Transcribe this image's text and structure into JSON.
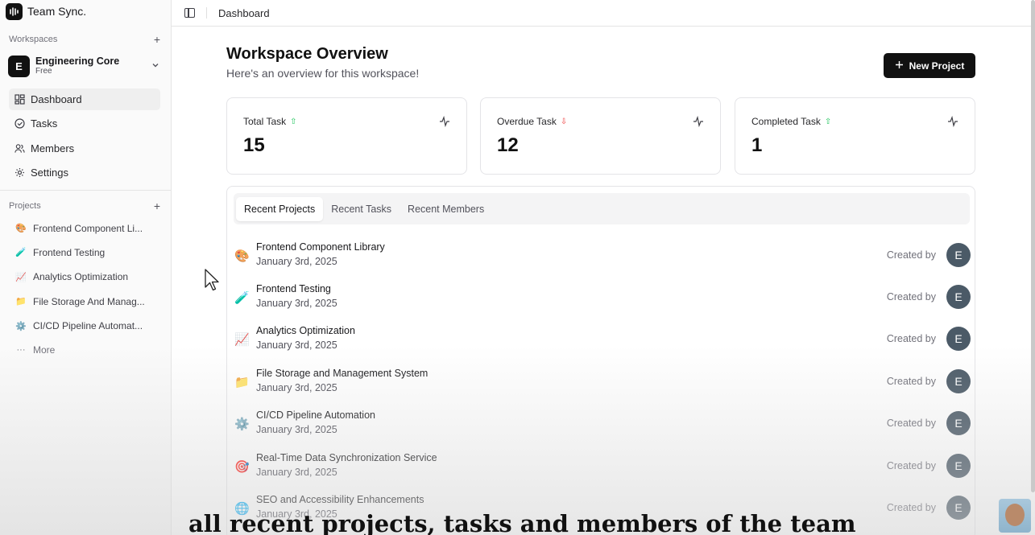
{
  "brand": {
    "name": "Team Sync."
  },
  "sidebar": {
    "workspaces_label": "Workspaces",
    "workspace": {
      "initial": "E",
      "name": "Engineering Core",
      "plan": "Free"
    },
    "nav": [
      {
        "label": "Dashboard",
        "icon": "grid-icon",
        "active": true
      },
      {
        "label": "Tasks",
        "icon": "check-circle-icon",
        "active": false
      },
      {
        "label": "Members",
        "icon": "users-icon",
        "active": false
      },
      {
        "label": "Settings",
        "icon": "gear-icon",
        "active": false
      }
    ],
    "projects_label": "Projects",
    "projects": [
      {
        "emoji": "🎨",
        "label": "Frontend Component Li..."
      },
      {
        "emoji": "🧪",
        "label": "Frontend Testing"
      },
      {
        "emoji": "📈",
        "label": "Analytics Optimization"
      },
      {
        "emoji": "📁",
        "label": "File Storage And Manag..."
      },
      {
        "emoji": "⚙️",
        "label": "CI/CD Pipeline Automat..."
      }
    ],
    "more_label": "More"
  },
  "topbar": {
    "title": "Dashboard"
  },
  "main": {
    "title": "Workspace Overview",
    "subtitle": "Here's an overview for this workspace!",
    "new_project_label": "New Project",
    "stats": [
      {
        "label": "Total Task",
        "value": "15",
        "trend": "up"
      },
      {
        "label": "Overdue Task",
        "value": "12",
        "trend": "down"
      },
      {
        "label": "Completed Task",
        "value": "1",
        "trend": "up"
      }
    ],
    "tabs": [
      "Recent Projects",
      "Recent Tasks",
      "Recent Members"
    ],
    "active_tab": "Recent Projects",
    "recent_projects": [
      {
        "emoji": "🎨",
        "name": "Frontend Component Library",
        "date": "January 3rd, 2025",
        "created_by": "Created by",
        "avatar": "E"
      },
      {
        "emoji": "🧪",
        "name": "Frontend Testing",
        "date": "January 3rd, 2025",
        "created_by": "Created by",
        "avatar": "E"
      },
      {
        "emoji": "📈",
        "name": "Analytics Optimization",
        "date": "January 3rd, 2025",
        "created_by": "Created by",
        "avatar": "E"
      },
      {
        "emoji": "📁",
        "name": "File Storage and Management System",
        "date": "January 3rd, 2025",
        "created_by": "Created by",
        "avatar": "E"
      },
      {
        "emoji": "⚙️",
        "name": "CI/CD Pipeline Automation",
        "date": "January 3rd, 2025",
        "created_by": "Created by",
        "avatar": "E"
      },
      {
        "emoji": "🎯",
        "name": "Real-Time Data Synchronization Service",
        "date": "January 3rd, 2025",
        "created_by": "Created by",
        "avatar": "E"
      },
      {
        "emoji": "🌐",
        "name": "SEO and Accessibility Enhancements",
        "date": "January 3rd, 2025",
        "created_by": "Created by",
        "avatar": "E"
      }
    ]
  },
  "caption": "all recent projects, tasks and members of the team",
  "colors": {
    "primary": "#111111",
    "trend_up": "#22c55e",
    "trend_down": "#ef4444",
    "avatar": "#4b5a67"
  }
}
